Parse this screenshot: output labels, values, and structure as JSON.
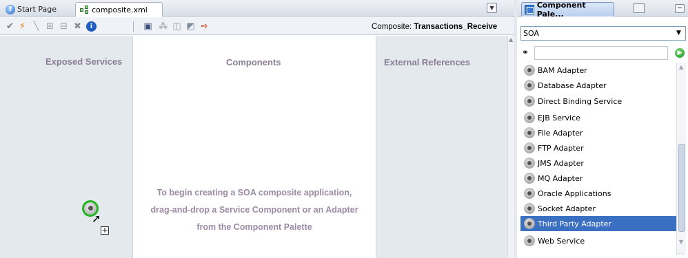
{
  "editor": {
    "tabs": [
      {
        "label": "Start Page",
        "icon": "help-icon"
      },
      {
        "label": "composite.xml",
        "icon": "composite-icon",
        "active": true
      }
    ],
    "composite_prefix": "Composite:",
    "composite_name": "Transactions_Receive",
    "toolbar_icons": [
      "validate-check-icon",
      "deploy-icon",
      "wire-icon",
      "zoom-in-icon",
      "zoom-out-icon",
      "delete-icon",
      "info-icon",
      "test-icon",
      "layout-icon",
      "refresh-icon",
      "export-icon",
      "annotate-icon"
    ],
    "lanes": {
      "exposed": "Exposed Services",
      "components": "Components",
      "external": "External References"
    },
    "hint_lines": [
      "To begin creating a SOA composite application,",
      "drag-and-drop a Service Component or an Adapter",
      "from the Component Palette"
    ],
    "accent_colors": {
      "lane_title": "#8a7d96",
      "hint": "#9b8aa4",
      "drag_ring": "#22b822"
    }
  },
  "palette": {
    "tab_label": "Component Pale...",
    "category": "SOA",
    "search_value": "",
    "items": [
      {
        "label": "BAM Adapter"
      },
      {
        "label": "Database Adapter"
      },
      {
        "label": "Direct Binding Service"
      },
      {
        "label": "EJB Service"
      },
      {
        "label": "File Adapter"
      },
      {
        "label": "FTP Adapter"
      },
      {
        "label": "JMS Adapter"
      },
      {
        "label": "MQ Adapter"
      },
      {
        "label": "Oracle Applications"
      },
      {
        "label": "Socket Adapter"
      },
      {
        "label": "Third Party Adapter",
        "selected": true
      },
      {
        "label": "Web Service"
      }
    ],
    "selection_color": "#3a6fc1"
  }
}
